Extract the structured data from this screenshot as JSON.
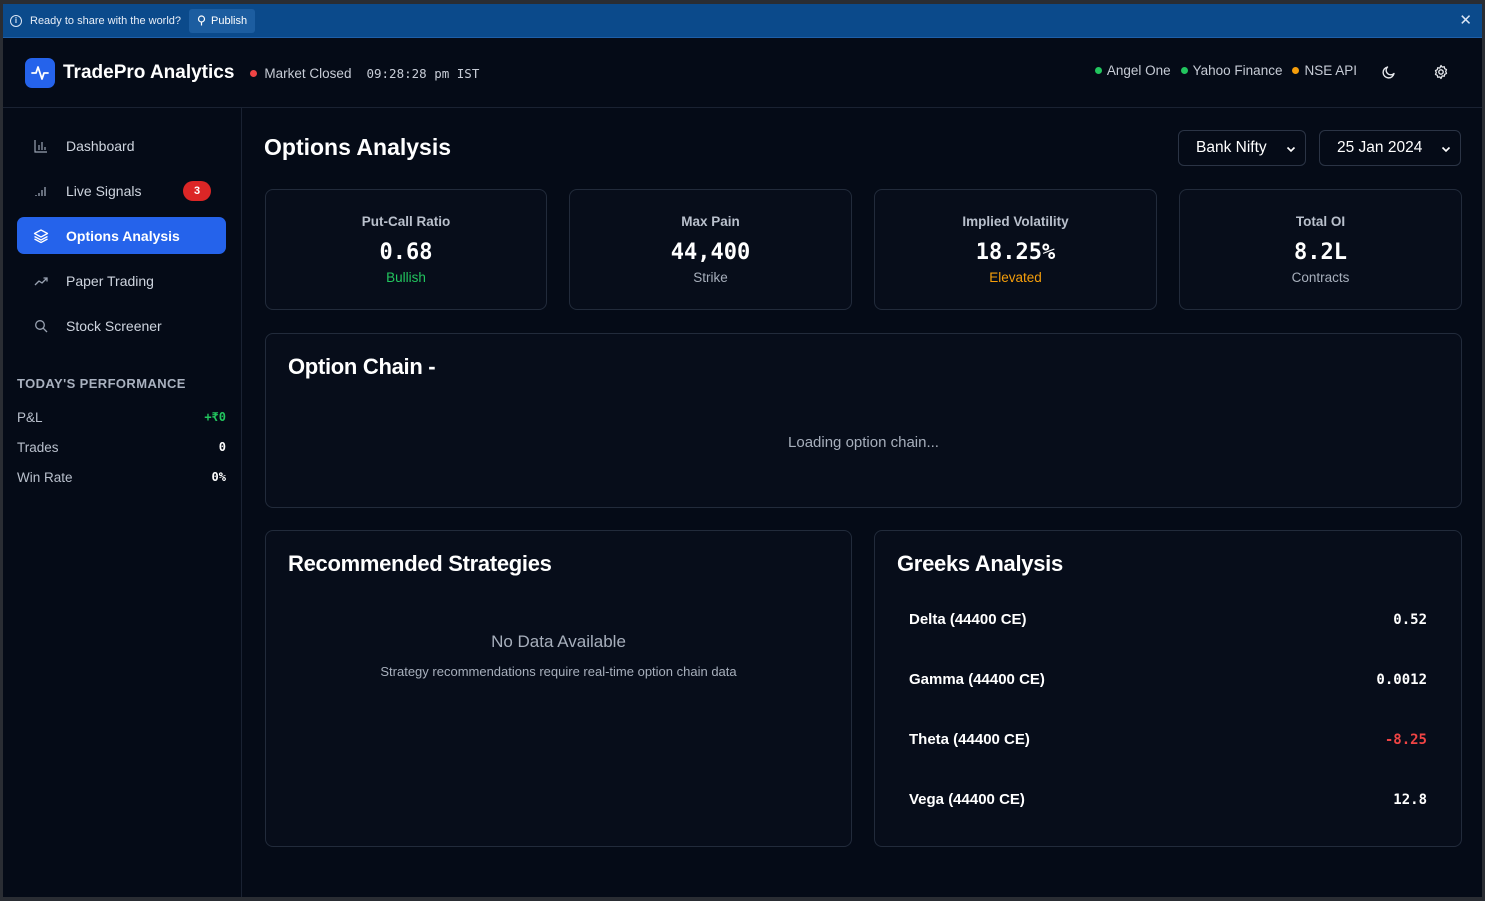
{
  "banner": {
    "message": "Ready to share with the world?",
    "publish_label": "Publish",
    "close": "✕"
  },
  "header": {
    "brand": "TradePro Analytics",
    "market_status": "Market Closed",
    "clock": "09:28:28 pm IST",
    "sources": [
      {
        "label": "Angel One",
        "color": "#22c55e"
      },
      {
        "label": "Yahoo Finance",
        "color": "#22c55e"
      },
      {
        "label": "NSE API",
        "color": "#f59e0b"
      }
    ]
  },
  "sidebar": {
    "items": [
      {
        "label": "Dashboard",
        "icon": "bar-chart-icon"
      },
      {
        "label": "Live Signals",
        "icon": "signal-icon",
        "badge": "3"
      },
      {
        "label": "Options Analysis",
        "icon": "layers-icon",
        "active": true
      },
      {
        "label": "Paper Trading",
        "icon": "trending-up-icon"
      },
      {
        "label": "Stock Screener",
        "icon": "search-icon"
      }
    ],
    "performance": {
      "title": "TODAY'S PERFORMANCE",
      "rows": [
        {
          "label": "P&L",
          "value": "+₹0"
        },
        {
          "label": "Trades",
          "value": "0"
        },
        {
          "label": "Win Rate",
          "value": "0%"
        }
      ]
    }
  },
  "main": {
    "title": "Options Analysis",
    "index_select": "Bank Nifty",
    "expiry_select": "25 Jan 2024",
    "stats": [
      {
        "title": "Put-Call Ratio",
        "value": "0.68",
        "sub": "Bullish"
      },
      {
        "title": "Max Pain",
        "value": "44,400",
        "sub": "Strike"
      },
      {
        "title": "Implied Volatility",
        "value": "18.25%",
        "sub": "Elevated"
      },
      {
        "title": "Total OI",
        "value": "8.2L",
        "sub": "Contracts"
      }
    ],
    "option_chain": {
      "title": "Option Chain -",
      "loading": "Loading option chain..."
    },
    "strategies": {
      "title": "Recommended Strategies",
      "empty_title": "No Data Available",
      "empty_sub": "Strategy recommendations require real-time option chain data"
    },
    "greeks": {
      "title": "Greeks Analysis",
      "rows": [
        {
          "name": "Delta (44400 CE)",
          "value": "0.52"
        },
        {
          "name": "Gamma (44400 CE)",
          "value": "0.0012"
        },
        {
          "name": "Theta (44400 CE)",
          "value": "-8.25"
        },
        {
          "name": "Vega (44400 CE)",
          "value": "12.8"
        }
      ]
    }
  },
  "colors": {
    "accent": "#2563eb",
    "positive": "#22c55e",
    "negative": "#ef4444",
    "warning": "#f59e0b",
    "background": "#050b17"
  }
}
